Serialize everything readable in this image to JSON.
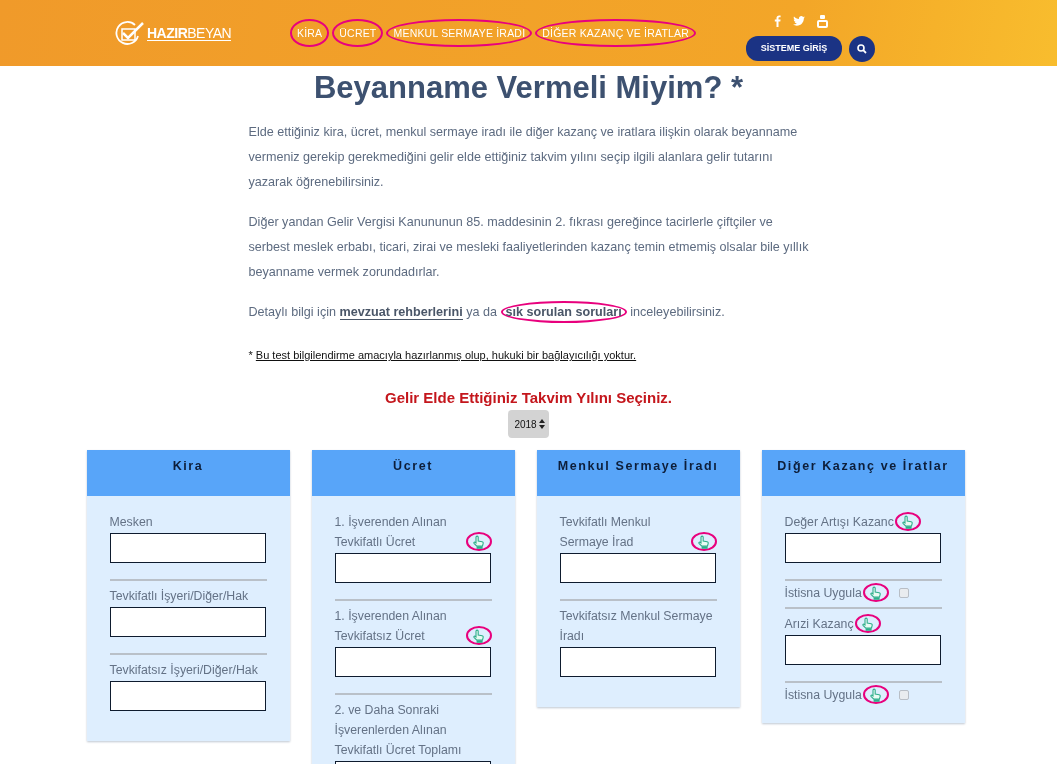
{
  "header": {
    "logo": "**HAZIR**BEYAN",
    "nav": [
      {
        "label": "KİRA",
        "highlighted": true
      },
      {
        "label": "ÜCRET",
        "highlighted": true
      },
      {
        "label": "MENKUL SERMAYE İRADI",
        "highlighted": true
      },
      {
        "label": "DİĞER KAZANÇ VE İRATLAR",
        "highlighted": true
      }
    ],
    "login_button": "SİSTEME GİRİŞ"
  },
  "title": "Beyanname Vermeli Miyim? *",
  "paragraphs": [
    "Elde ettiğiniz kira, ücret, menkul sermaye iradı ile diğer kazanç ve iratlara ilişkin olarak beyanname vermeniz gerekip gerekmediğini gelir elde ettiğiniz takvim yılını seçip ilgili alanlara gelir tutarını yazarak öğrenebilirsiniz.",
    "Diğer yandan Gelir Vergisi Kanununun 85. maddesinin 2. fıkrası gereğince tacirlerle çiftçiler ve serbest meslek erbabı, ticari, zirai ve mesleki faaliyetlerinden kazanç temin etmemiş olsalar bile yıllık beyanname vermek zorundadırlar."
  ],
  "info": [
    {
      "kind": "text",
      "text": "Detaylı bilgi için "
    },
    {
      "kind": "link",
      "text": "mevzuat rehberlerini",
      "highlighted": false
    },
    {
      "kind": "text",
      "text": " ya da "
    },
    {
      "kind": "link",
      "text": "sık sorulan soruları",
      "highlighted": true
    },
    {
      "kind": "text",
      "text": " inceleyebilirsiniz."
    }
  ],
  "footnote": {
    "mark": "*",
    "link": "Bu test bilgilendirme amacıyla hazırlanmış olup, hukuki bir bağlayıcılığı yoktur."
  },
  "year_prompt": "Gelir Elde Ettiğiniz Takvim Yılını Seçiniz.",
  "year_select": "2018",
  "cards": [
    {
      "title": "Kira",
      "fields": [
        {
          "label": "Mesken",
          "kind": "input",
          "hint": false
        },
        {
          "label": "Tevkifatlı İşyeri/Diğer/Hak",
          "kind": "input",
          "hint": false
        },
        {
          "label": "Tevkifatsız İşyeri/Diğer/Hak",
          "kind": "input",
          "hint": false
        }
      ]
    },
    {
      "title": "Ücret",
      "fields": [
        {
          "label": "1. İşverenden Alınan Tevkifatlı Ücret",
          "kind": "input",
          "hint": true
        },
        {
          "label": "1. İşverenden Alınan Tevkifatsız Ücret",
          "kind": "input",
          "hint": true
        },
        {
          "label": "2. ve Daha Sonraki İşverenlerden Alınan Tevkifatlı Ücret Toplamı",
          "kind": "input",
          "hint": false
        }
      ]
    },
    {
      "title": "Menkul Sermaye İradı",
      "fields": [
        {
          "label": "Tevkifatlı Menkul Sermaye İrad",
          "kind": "input",
          "hint": true
        },
        {
          "label": "Tevkifatsız Menkul Sermaye İradı",
          "kind": "input",
          "hint": false
        }
      ]
    },
    {
      "title": "Diğer Kazanç ve İratlar",
      "fields": [
        {
          "label": "Değer Artışı Kazanc",
          "kind": "input",
          "hint": true
        },
        {
          "label": "İstisna Uygula",
          "kind": "checkbox",
          "hint": true,
          "checked": false
        },
        {
          "label": "Arızi Kazanç",
          "kind": "input",
          "hint": true
        },
        {
          "label": "İstisna Uygula",
          "kind": "checkbox",
          "hint": true,
          "checked": false
        }
      ]
    }
  ]
}
